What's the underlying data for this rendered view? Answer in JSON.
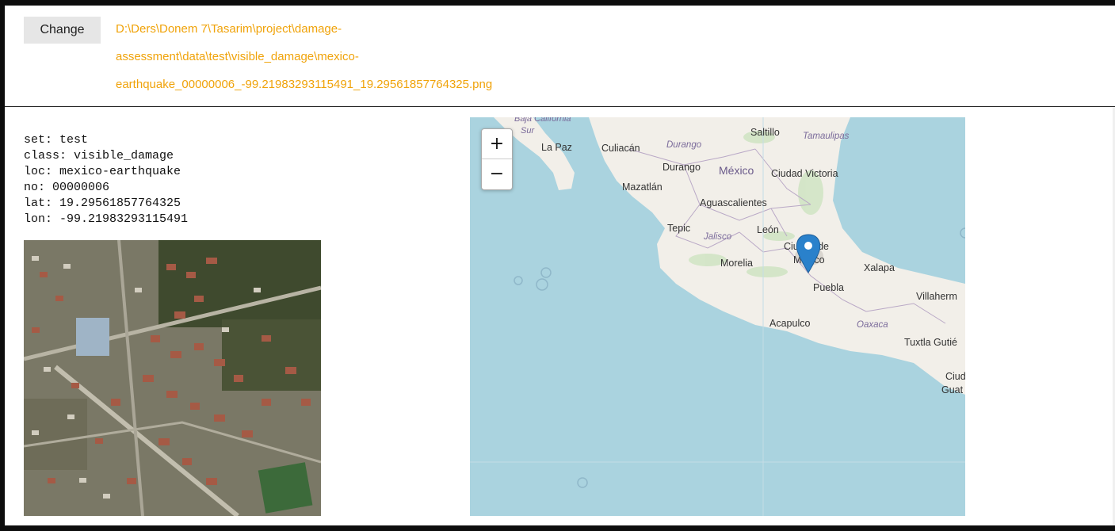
{
  "toolbar": {
    "change_label": "Change",
    "path_lines": [
      "D:\\Ders\\Donem 7\\Tasarim\\project\\damage-",
      "assessment\\data\\test\\visible_damage\\mexico-",
      "earthquake_00000006_-99.21983293115491_19.29561857764325.png"
    ]
  },
  "meta": {
    "set": "set: test",
    "class": "class: visible_damage",
    "loc": "loc: mexico-earthquake",
    "no": "no: 00000006",
    "lat": "lat: 19.29561857764325",
    "lon": "lon: -99.21983293115491"
  },
  "map": {
    "zoom_in": "+",
    "zoom_out": "−",
    "labels": {
      "baja": "Baja California",
      "sur": "Sur",
      "lapaz": "La Paz",
      "culiacan": "Culiacán",
      "durango_state": "Durango",
      "saltillo": "Saltillo",
      "tamaulipas": "Tamaulipas",
      "durango": "Durango",
      "mexico": "México",
      "victoria": "Ciudad Victoria",
      "mazatlan": "Mazatlán",
      "aguascalientes": "Aguascalientes",
      "tepic": "Tepic",
      "jalisco": "Jalisco",
      "leon": "León",
      "cdmx1": "Ciudad de",
      "cdmx2": "México",
      "morelia": "Morelia",
      "xalapa": "Xalapa",
      "puebla": "Puebla",
      "villahermosa": "Villaherm",
      "acapulco": "Acapulco",
      "oaxaca": "Oaxaca",
      "tuxtla": "Tuxtla Gutié",
      "guat1": "Ciud",
      "guat2": "Guat"
    },
    "colors": {
      "water": "#aad3df",
      "land": "#f2efe9",
      "marker": "#2a81cb"
    }
  }
}
